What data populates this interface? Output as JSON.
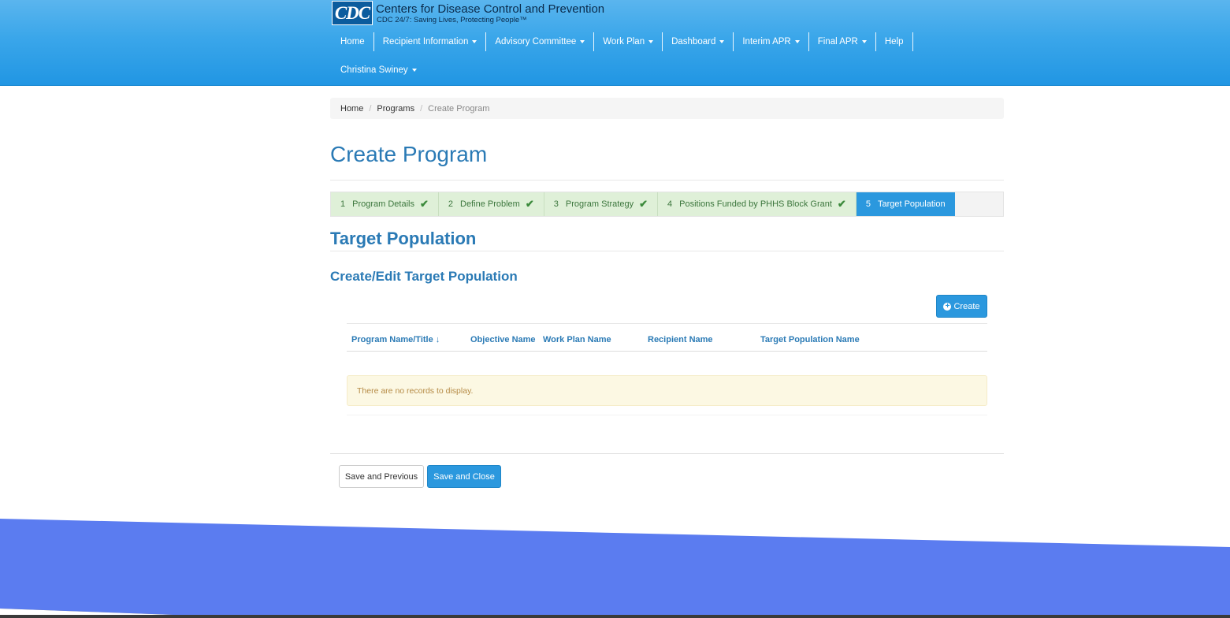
{
  "brand": {
    "logo": "CDC",
    "title": "Centers for Disease Control and Prevention",
    "tagline": "CDC 24/7: Saving Lives, Protecting People™"
  },
  "nav": [
    {
      "label": "Home",
      "dropdown": false
    },
    {
      "label": "Recipient Information",
      "dropdown": true
    },
    {
      "label": "Advisory Committee",
      "dropdown": true
    },
    {
      "label": "Work Plan",
      "dropdown": true
    },
    {
      "label": "Dashboard",
      "dropdown": true
    },
    {
      "label": "Interim APR",
      "dropdown": true
    },
    {
      "label": "Final APR",
      "dropdown": true
    },
    {
      "label": "Help",
      "dropdown": false
    }
  ],
  "user": {
    "name": "Christina Swiney"
  },
  "breadcrumb": {
    "home": "Home",
    "programs": "Programs",
    "current": "Create Program"
  },
  "page": {
    "title": "Create Program"
  },
  "steps": [
    {
      "num": "1",
      "label": "Program Details",
      "done": true
    },
    {
      "num": "2",
      "label": "Define Problem",
      "done": true
    },
    {
      "num": "3",
      "label": "Program Strategy",
      "done": true
    },
    {
      "num": "4",
      "label": "Positions Funded by PHHS Block Grant",
      "done": true
    },
    {
      "num": "5",
      "label": "Target Population",
      "done": false
    }
  ],
  "section": {
    "title": "Target Population",
    "subtitle": "Create/Edit Target Population"
  },
  "toolbar": {
    "create_label": "Create"
  },
  "grid": {
    "columns": [
      "Program Name/Title",
      "Objective Name",
      "Work Plan Name",
      "Recipient Name",
      "Target Population Name"
    ],
    "empty_message": "There are no records to display."
  },
  "actions": {
    "prev_label": "Save and Previous",
    "close_label": "Save and Close"
  },
  "colors": {
    "accent": "#2b98de",
    "heading": "#2a7ab5",
    "success_bg": "#dff0d8",
    "footer": "#5b7cf0"
  }
}
